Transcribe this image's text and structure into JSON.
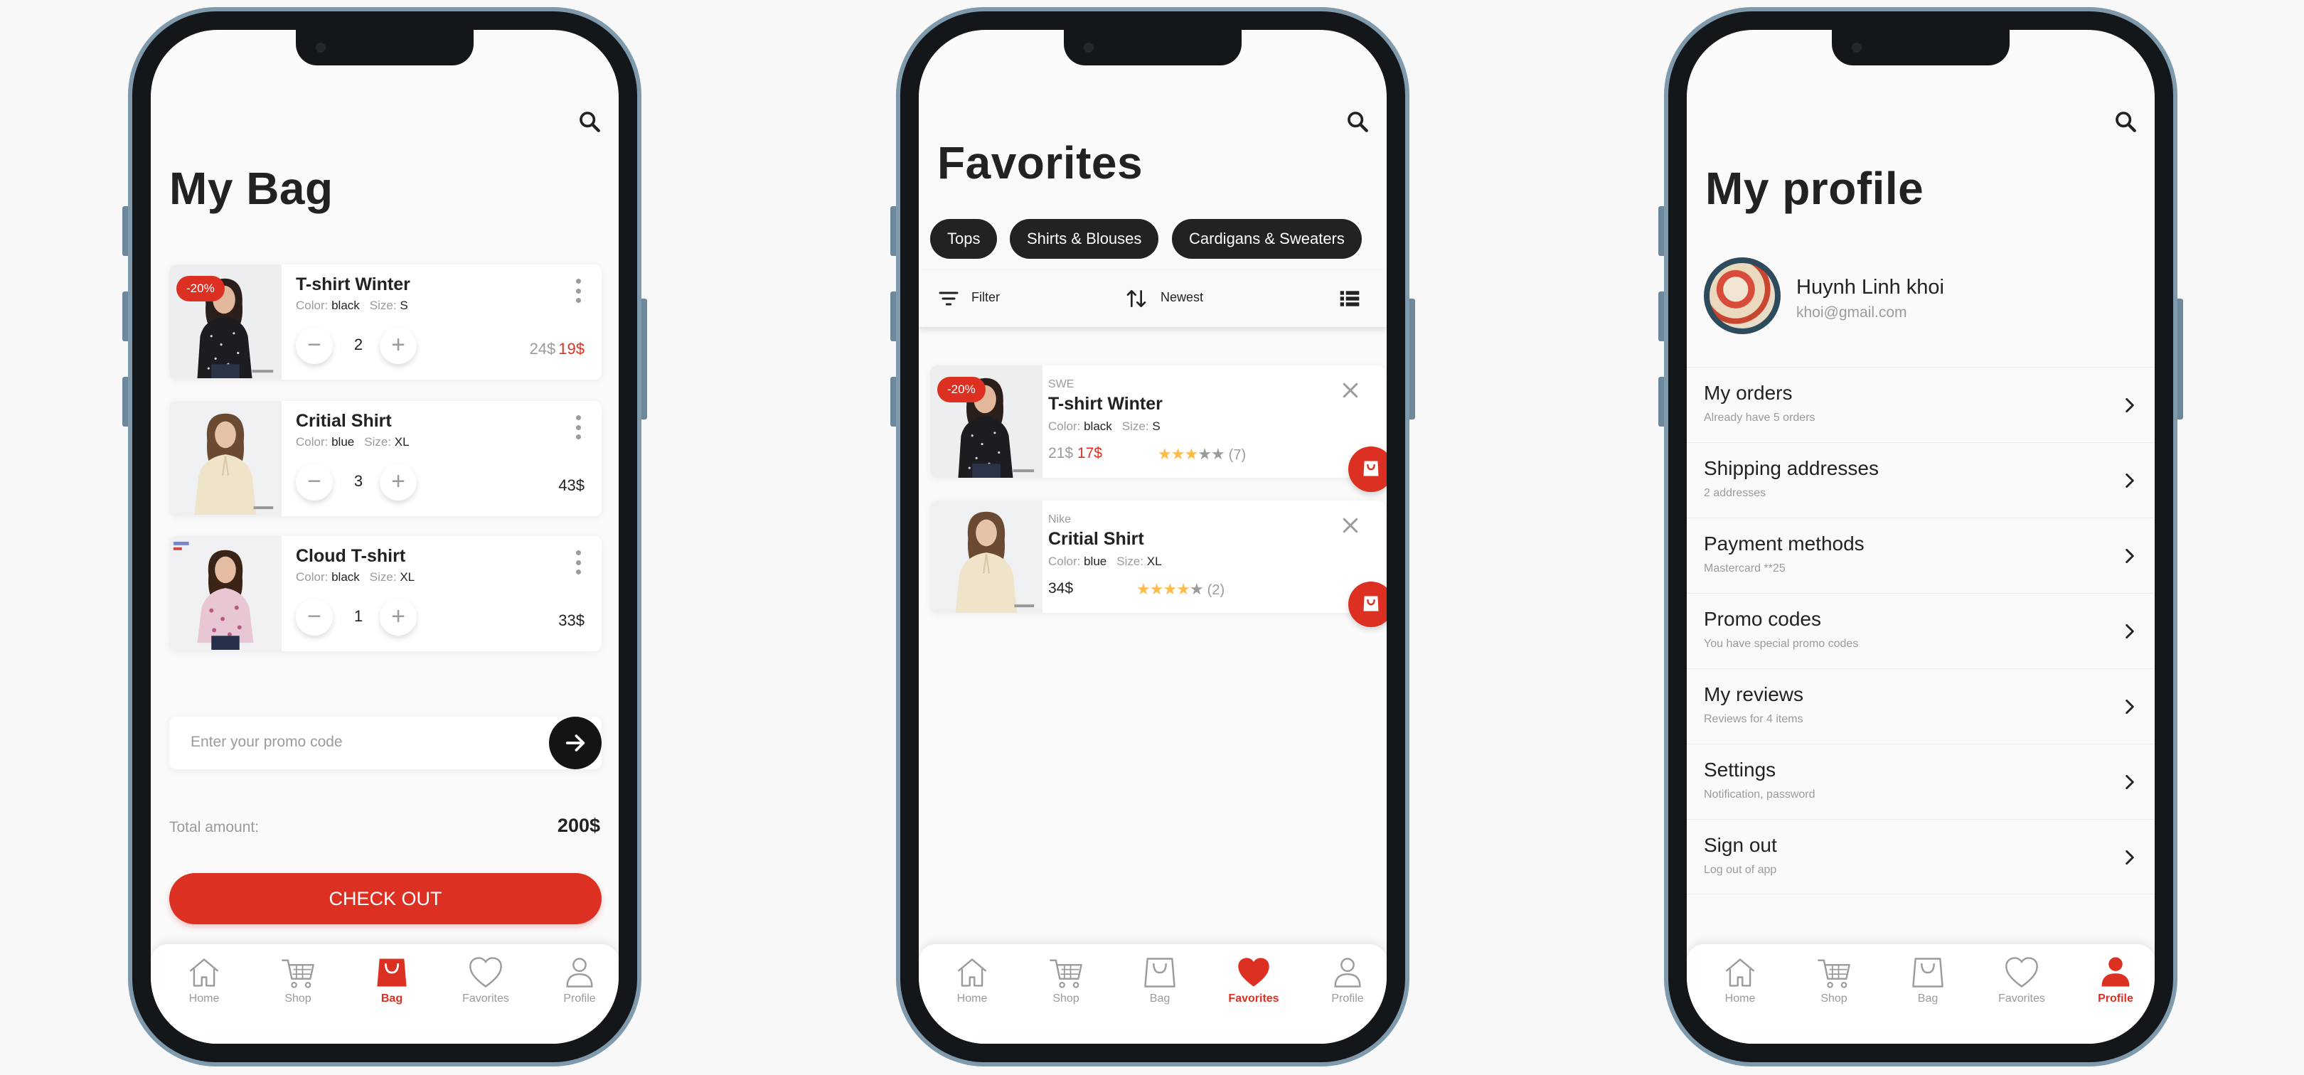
{
  "colors": {
    "accent": "#DB3022",
    "text": "#222222",
    "muted": "#9B9B9B",
    "background": "#FAFAFA",
    "star": "#FFBA49"
  },
  "tabs": {
    "home": {
      "label": "Home",
      "icon": "home-icon"
    },
    "shop": {
      "label": "Shop",
      "icon": "cart-icon"
    },
    "bag": {
      "label": "Bag",
      "icon": "bag-icon"
    },
    "favorites": {
      "label": "Favorites",
      "icon": "heart-icon"
    },
    "profile": {
      "label": "Profile",
      "icon": "person-icon"
    }
  },
  "bag_screen": {
    "title": "My Bag",
    "active_tab": "bag",
    "items": [
      {
        "name": "T-shirt Winter",
        "color_label": "Color:",
        "color": "black",
        "size_label": "Size:",
        "size": "S",
        "quantity": "2",
        "old_price": "24$",
        "price": "19$",
        "discount": "-20%"
      },
      {
        "name": "Critial Shirt",
        "color_label": "Color:",
        "color": "blue",
        "size_label": "Size:",
        "size": "XL",
        "quantity": "3",
        "price": "43$"
      },
      {
        "name": "Cloud T-shirt",
        "color_label": "Color:",
        "color": "black",
        "size_label": "Size:",
        "size": "XL",
        "quantity": "1",
        "price": "33$"
      }
    ],
    "promo_placeholder": "Enter your promo code",
    "total_label": "Total amount:",
    "total_value": "200$",
    "checkout_label": "CHECK OUT"
  },
  "favorites_screen": {
    "title": "Favorites",
    "active_tab": "favorites",
    "chips": [
      "Tops",
      "Shirts & Blouses",
      "Cardigans & Sweaters"
    ],
    "filter_label": "Filter",
    "sort_label": "Newest",
    "items": [
      {
        "brand": "SWE",
        "name": "T-shirt Winter",
        "color_label": "Color:",
        "color": "black",
        "size_label": "Size:",
        "size": "S",
        "old_price": "21$",
        "price": "17$",
        "rating": 3,
        "reviews": "(7)",
        "discount": "-20%"
      },
      {
        "brand": "Nike",
        "name": "Critial Shirt",
        "color_label": "Color:",
        "color": "blue",
        "size_label": "Size:",
        "size": "XL",
        "price": "34$",
        "rating": 4,
        "reviews": "(2)"
      }
    ]
  },
  "profile_screen": {
    "title": "My profile",
    "active_tab": "profile",
    "user_name": "Huynh Linh khoi",
    "user_email": "khoi@gmail.com",
    "menu": [
      {
        "title": "My orders",
        "subtitle": "Already have 5 orders"
      },
      {
        "title": "Shipping addresses",
        "subtitle": "2 addresses"
      },
      {
        "title": "Payment methods",
        "subtitle": "Mastercard **25"
      },
      {
        "title": "Promo codes",
        "subtitle": "You have special promo codes"
      },
      {
        "title": "My reviews",
        "subtitle": "Reviews for 4 items"
      },
      {
        "title": "Settings",
        "subtitle": "Notification, password"
      },
      {
        "title": "Sign out",
        "subtitle": "Log out of app"
      }
    ]
  }
}
